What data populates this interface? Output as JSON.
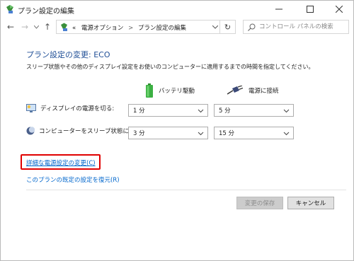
{
  "window": {
    "title": "プラン設定の編集",
    "controls": {
      "minimize": "—",
      "maximize": "☐",
      "close": "✕"
    }
  },
  "address": {
    "prefix": "«",
    "crumbs": [
      "電源オプション",
      "プラン設定の編集"
    ],
    "separator": ">"
  },
  "search": {
    "placeholder": "コントロール パネルの検索"
  },
  "nav": {
    "back": "←",
    "forward": "→",
    "recent": "⌄",
    "up": "↑",
    "refresh": "↻"
  },
  "main": {
    "title": "プラン設定の変更: ECO",
    "description": "スリープ状態やその他のディスプレイ設定をお使いのコンピューターに適用するまでの時間を指定してください。",
    "columns": {
      "battery": "バッテリ駆動",
      "plugged": "電源に接続"
    },
    "rows": [
      {
        "label": "ディスプレイの電源を切る:",
        "battery": "1 分",
        "plugged": "5 分"
      },
      {
        "label": "コンピューターをスリープ状態にする:",
        "battery": "3 分",
        "plugged": "15 分"
      }
    ],
    "links": {
      "advanced": "詳細な電源設定の変更(C)",
      "restore": "このプランの既定の設定を復元(R)"
    },
    "buttons": {
      "save": "変更の保存",
      "cancel": "キャンセル"
    }
  },
  "colors": {
    "accent": "#1f4e96",
    "link": "#0066cc",
    "highlight": "#e00000"
  }
}
